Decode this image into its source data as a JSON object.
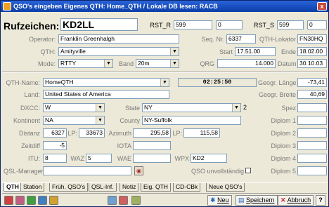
{
  "window": {
    "title": "QSO's eingeben  Eigenes QTH: Home_QTH / Lokale DB lesen: RACB",
    "close": "x"
  },
  "qso": {
    "call_label": "Rufzeichen:",
    "call_value": "KD2LL",
    "rst_r_label": "RST_R",
    "rst_r_value": "599",
    "rst_r_extra": "0",
    "rst_s_label": "RST_S",
    "rst_s_value": "599",
    "rst_s_extra": "0",
    "operator_label": "Operator:",
    "operator_value": "Franklin Greenhalgh",
    "seq_label": "Seq. Nr.",
    "seq_value": "6337",
    "locator_label": "QTH-Lokator",
    "locator_value": "FN30HQ",
    "qth_label": "QTH:",
    "qth_value": "Amityville",
    "start_label": "Start",
    "start_value": "17.51.00",
    "end_label": "Ende",
    "end_value": "18.02.00",
    "mode_label": "Mode:",
    "mode_value": "RTTY",
    "band_label": "Band",
    "band_value": "20m",
    "qrg_label": "QRG",
    "qrg_value": "14.000",
    "date_label": "Datum",
    "date_value": "30.10.03"
  },
  "details": {
    "qthname_label": "QTH-Name:",
    "qthname_value": "HomeQTH",
    "time_display": "02:25:50",
    "land_label": "Land:",
    "land_value": "United States of America",
    "dxcc_label": "DXCC:",
    "dxcc_value": "W",
    "state_label": "State",
    "state_value": "NY",
    "state_suffix": "2",
    "kontinent_label": "Kontinent",
    "kontinent_value": "NA",
    "county_label": "County",
    "county_value": "NY-Suffolk",
    "distanz_label": "Distanz",
    "distanz_value": "6327",
    "lp_label": "LP:",
    "lp_value": "33673",
    "azimuth_label": "Azimuth",
    "azimuth_value": "295,58",
    "lp2_label": "LP:",
    "lp2_value": "115,58",
    "zeitdiff_label": "Zeitdiff",
    "zeitdiff_value": "-5",
    "iota_label": "IOTA",
    "iota_value": "",
    "itu_label": "ITU:",
    "itu_value": "8",
    "waz_label": "WAZ",
    "waz_value": "5",
    "wae_label": "WAE",
    "wae_value": "",
    "wpx_label": "WPX",
    "wpx_value": "KD2",
    "qslmgr_label": "QSL-Manager",
    "qslmgr_value": "",
    "qso_incomplete_label": "QSO unvollständig",
    "geo_lon_label": "Geogr. Länge",
    "geo_lon_value": "-73,41",
    "geo_lat_label": "Geogr. Breite",
    "geo_lat_value": "40,69",
    "spez_label": "Spez",
    "diplom1_label": "Diplom 1",
    "diplom2_label": "Diplom 2",
    "diplom3_label": "Diplom 3",
    "diplom4_label": "Diplom 4",
    "diplom5_label": "Diplom 5"
  },
  "tabs": [
    "QTH",
    "Station",
    "Früh. QSO's",
    "QSL-Inf.",
    "Notiz",
    "Eig. QTH",
    "CD-CBk",
    "Neue QSO's"
  ],
  "toolbar": {
    "new_label": "Neu",
    "save_label": "Speichern",
    "cancel_label": "Abbruch",
    "help_label": "?"
  },
  "colors": {
    "titlebar": "#0a3ea8",
    "window_bg": "#ece9d8"
  }
}
